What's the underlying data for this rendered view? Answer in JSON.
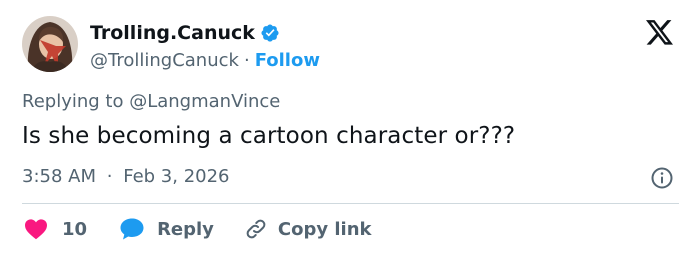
{
  "author": {
    "display_name": "Trolling.Canuck",
    "handle": "@TrollingCanuck",
    "separator": "·",
    "follow_label": "Follow",
    "verified_color": "#1d9bf0"
  },
  "brand": {
    "logo_icon": "x-logo-icon"
  },
  "tweet": {
    "replying_prefix": "Replying to",
    "replying_handle": "@LangmanVince",
    "text": "Is she becoming a cartoon character or???",
    "time": "3:58 AM",
    "separator": "·",
    "date": "Feb 3, 2026"
  },
  "actions": {
    "like_count": "10",
    "like_color": "#f91880",
    "reply_label": "Reply",
    "reply_icon_color": "#1d9bf0",
    "copy_label": "Copy link"
  },
  "colors": {
    "text_primary": "#0f1419",
    "text_secondary": "#536471",
    "accent": "#1d9bf0",
    "divider": "#cfd9de"
  }
}
